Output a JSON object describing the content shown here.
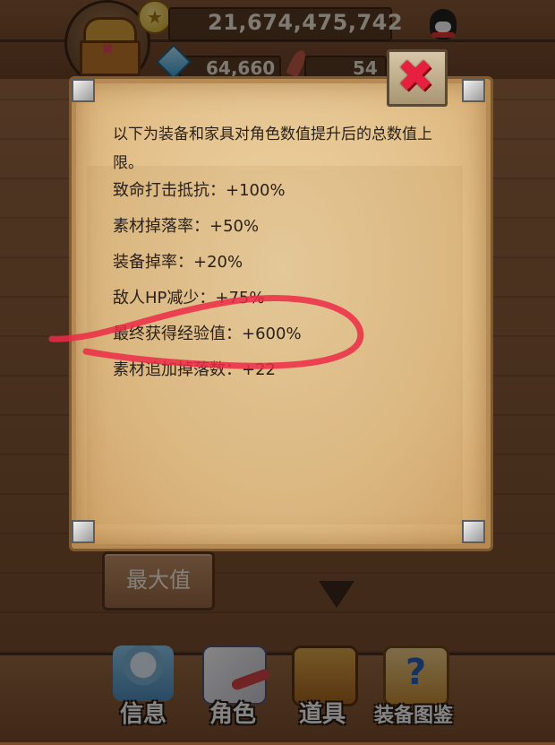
{
  "top_bar": {
    "gold_amount": "21,674,475,742",
    "gem_amount": "64,660",
    "feather_amount": "54",
    "coin_icon": "star-coin-icon",
    "gem_icon": "blue-gem-icon",
    "feather_icon": "red-feather-icon",
    "qq_icon": "qq-penguin-icon",
    "portrait_icon": "treasure-chest-icon"
  },
  "dialog": {
    "intro": "以下为装备和家具对角色数值提升后的总数值上限。",
    "stats": [
      {
        "text": "致命打击抵抗：+100%"
      },
      {
        "text": "素材掉落率：+50%"
      },
      {
        "text": "装备掉率：+20%"
      },
      {
        "text": "敌人HP减少：+75%"
      },
      {
        "text": "最终获得经验值：+600%"
      },
      {
        "text": "素材追加掉落数：+22"
      }
    ],
    "close_icon": "close-x-icon",
    "highlight_color": "#ec2a46"
  },
  "background": {
    "max_button_label": "最大值"
  },
  "bottom_nav": {
    "tabs": [
      {
        "label": "信息",
        "icon": "info-angel-icon"
      },
      {
        "label": "角色",
        "icon": "role-gift-icon"
      },
      {
        "label": "道具",
        "icon": "item-chest-icon"
      },
      {
        "label": "装备图鉴",
        "icon": "codex-book-icon"
      }
    ]
  }
}
